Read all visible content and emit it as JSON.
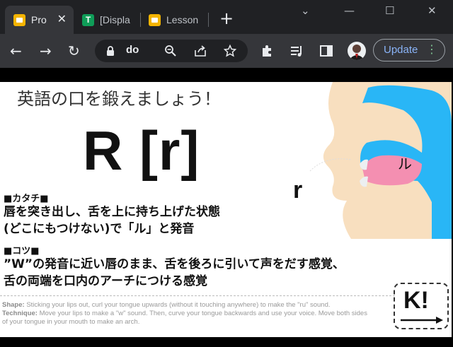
{
  "browser": {
    "tabs": [
      {
        "label": "Pro",
        "favicon": "slides-icon",
        "active": true,
        "close": "✕"
      },
      {
        "label": "[Displa",
        "favicon": "sheets-icon",
        "fav_letter": "T",
        "active": false
      },
      {
        "label": "Lesson",
        "favicon": "slides-icon",
        "active": false
      }
    ],
    "new_tab": "+",
    "window_controls": {
      "dropdown": "⌄",
      "minimize": "—",
      "maximize": "☐",
      "close": "✕"
    },
    "nav": {
      "back": "←",
      "forward": "→",
      "reload": "↻"
    },
    "omnibox": {
      "url": "do",
      "icons": [
        "lock-icon",
        "zoom-icon",
        "share-icon",
        "star-icon"
      ]
    },
    "toolbar_icons": [
      "extensions-icon",
      "reading-list-icon",
      "sidebar-icon",
      "avatar"
    ],
    "update_label": "Update",
    "menu_dots": "⋮",
    "colors": {
      "tab_bar": "#202124",
      "toolbar": "#35363a",
      "update_text": "#8ab4f8",
      "menu_dots": "#81c995"
    }
  },
  "slide": {
    "heading": "英語の口を鍛えましょう！",
    "sound": "R [r]",
    "section1_label": "■カタチ■",
    "section1_line1": "唇を突き出し、舌を上に持ち上げた状態",
    "section1_line2": "(どこにもつけない)で「ル」と発音",
    "section2_label": "■コツ■",
    "section2_line1": "”W”の発音に近い唇のまま、舌を後ろに引いて声をだす感覚、",
    "section2_line2": "舌の両端を口内のアーチにつける感覚",
    "shape_label": "Shape:",
    "shape_text": "Sticking your lips out, curl your tongue upwards (without it touching anywhere) to make the \"ru\" sound.",
    "technique_label": "Technique:",
    "technique_text": "Move your lips to make a \"w\" sound. Then, curve your tongue backwards and use your voice.  Move both sides of your tongue in your mouth to make an arch.",
    "diagram_letter": "r",
    "diagram_tongue_label": "ル",
    "logo_text": "K!",
    "colors": {
      "skin": "#f8dfbf",
      "mouth": "#29b6f6",
      "tongue": "#f48fb1",
      "teeth": "#eceff1"
    }
  }
}
